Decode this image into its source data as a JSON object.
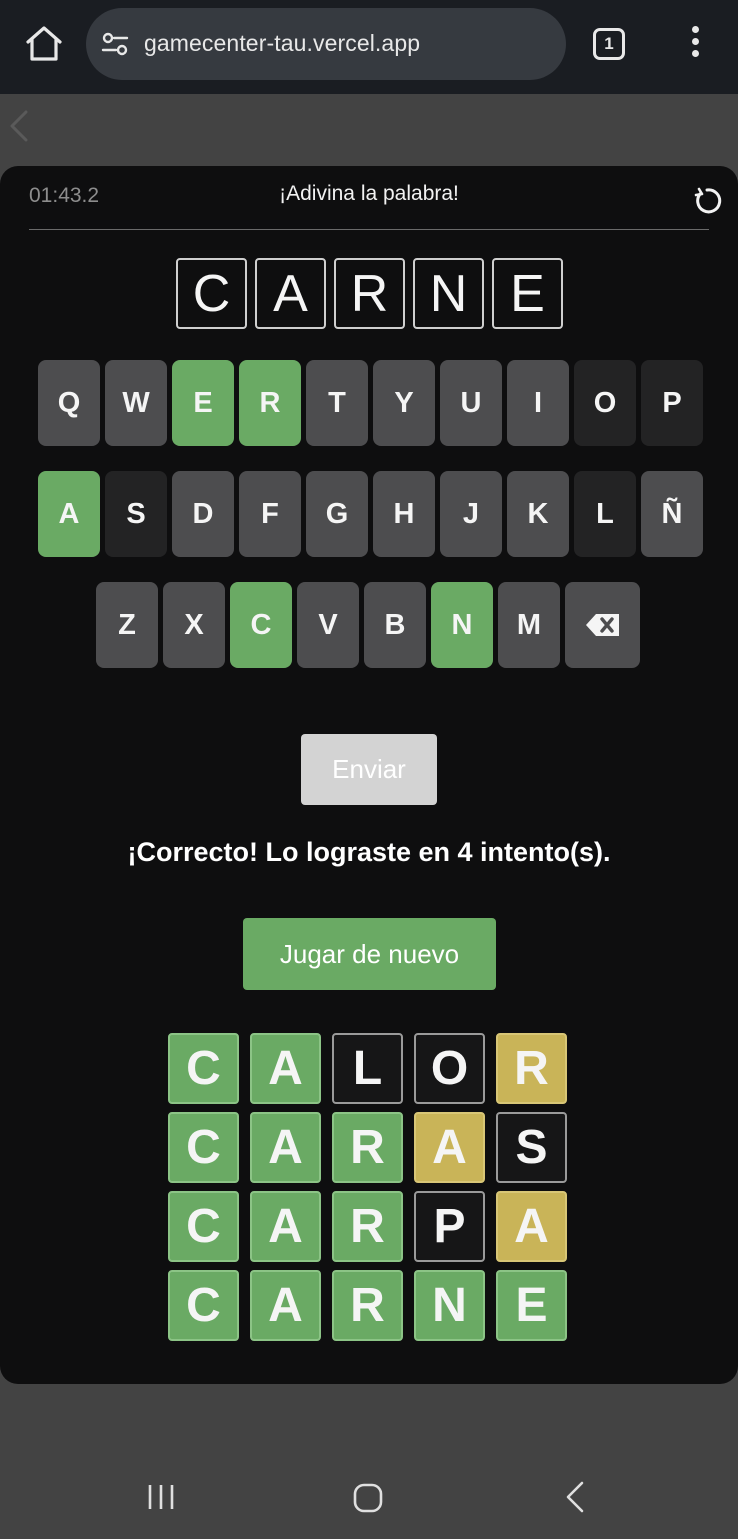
{
  "browser": {
    "url": "gamecenter-tau.vercel.app",
    "tab_count": "1",
    "icons": [
      "home-icon",
      "site-settings-icon",
      "tabs-icon",
      "more-vert-icon",
      "back-chevron-icon"
    ]
  },
  "game": {
    "timer": "01:43.2",
    "title": "¡Adivina la palabra!",
    "restart_icon": "restart-icon",
    "current_guess": [
      "C",
      "A",
      "R",
      "N",
      "E"
    ],
    "keyboard": {
      "rows": [
        [
          {
            "label": "Q",
            "state": "unused"
          },
          {
            "label": "W",
            "state": "unused"
          },
          {
            "label": "E",
            "state": "correct"
          },
          {
            "label": "R",
            "state": "correct"
          },
          {
            "label": "T",
            "state": "unused"
          },
          {
            "label": "Y",
            "state": "unused"
          },
          {
            "label": "U",
            "state": "unused"
          },
          {
            "label": "I",
            "state": "unused"
          },
          {
            "label": "O",
            "state": "absent"
          },
          {
            "label": "P",
            "state": "absent"
          }
        ],
        [
          {
            "label": "A",
            "state": "correct"
          },
          {
            "label": "S",
            "state": "absent"
          },
          {
            "label": "D",
            "state": "unused"
          },
          {
            "label": "F",
            "state": "unused"
          },
          {
            "label": "G",
            "state": "unused"
          },
          {
            "label": "H",
            "state": "unused"
          },
          {
            "label": "J",
            "state": "unused"
          },
          {
            "label": "K",
            "state": "unused"
          },
          {
            "label": "L",
            "state": "absent"
          },
          {
            "label": "Ñ",
            "state": "unused"
          }
        ],
        [
          {
            "label": "Z",
            "state": "unused"
          },
          {
            "label": "X",
            "state": "unused"
          },
          {
            "label": "C",
            "state": "correct"
          },
          {
            "label": "V",
            "state": "unused"
          },
          {
            "label": "B",
            "state": "unused"
          },
          {
            "label": "N",
            "state": "correct"
          },
          {
            "label": "M",
            "state": "unused"
          },
          {
            "label": "",
            "state": "unused",
            "icon": "backspace-icon"
          }
        ]
      ]
    },
    "send_label": "Enviar",
    "result_message": "¡Correcto! Lo lograste en 4 intento(s).",
    "play_again_label": "Jugar de nuevo",
    "history": [
      [
        {
          "l": "C",
          "s": "correct"
        },
        {
          "l": "A",
          "s": "correct"
        },
        {
          "l": "L",
          "s": "absent"
        },
        {
          "l": "O",
          "s": "absent"
        },
        {
          "l": "R",
          "s": "present"
        }
      ],
      [
        {
          "l": "C",
          "s": "correct"
        },
        {
          "l": "A",
          "s": "correct"
        },
        {
          "l": "R",
          "s": "correct"
        },
        {
          "l": "A",
          "s": "present"
        },
        {
          "l": "S",
          "s": "absent"
        }
      ],
      [
        {
          "l": "C",
          "s": "correct"
        },
        {
          "l": "A",
          "s": "correct"
        },
        {
          "l": "R",
          "s": "correct"
        },
        {
          "l": "P",
          "s": "absent"
        },
        {
          "l": "A",
          "s": "present"
        }
      ],
      [
        {
          "l": "C",
          "s": "correct"
        },
        {
          "l": "A",
          "s": "correct"
        },
        {
          "l": "R",
          "s": "correct"
        },
        {
          "l": "N",
          "s": "correct"
        },
        {
          "l": "E",
          "s": "correct"
        }
      ]
    ]
  },
  "colors": {
    "correct": "#6aaa64",
    "present": "#c9b458",
    "absent": "#232324",
    "unused": "#4d4d4f",
    "panel": "#0e0e0f",
    "page": "#434343"
  },
  "nav": {
    "icons": [
      "recents-icon",
      "home-circle-icon",
      "back-icon"
    ]
  }
}
